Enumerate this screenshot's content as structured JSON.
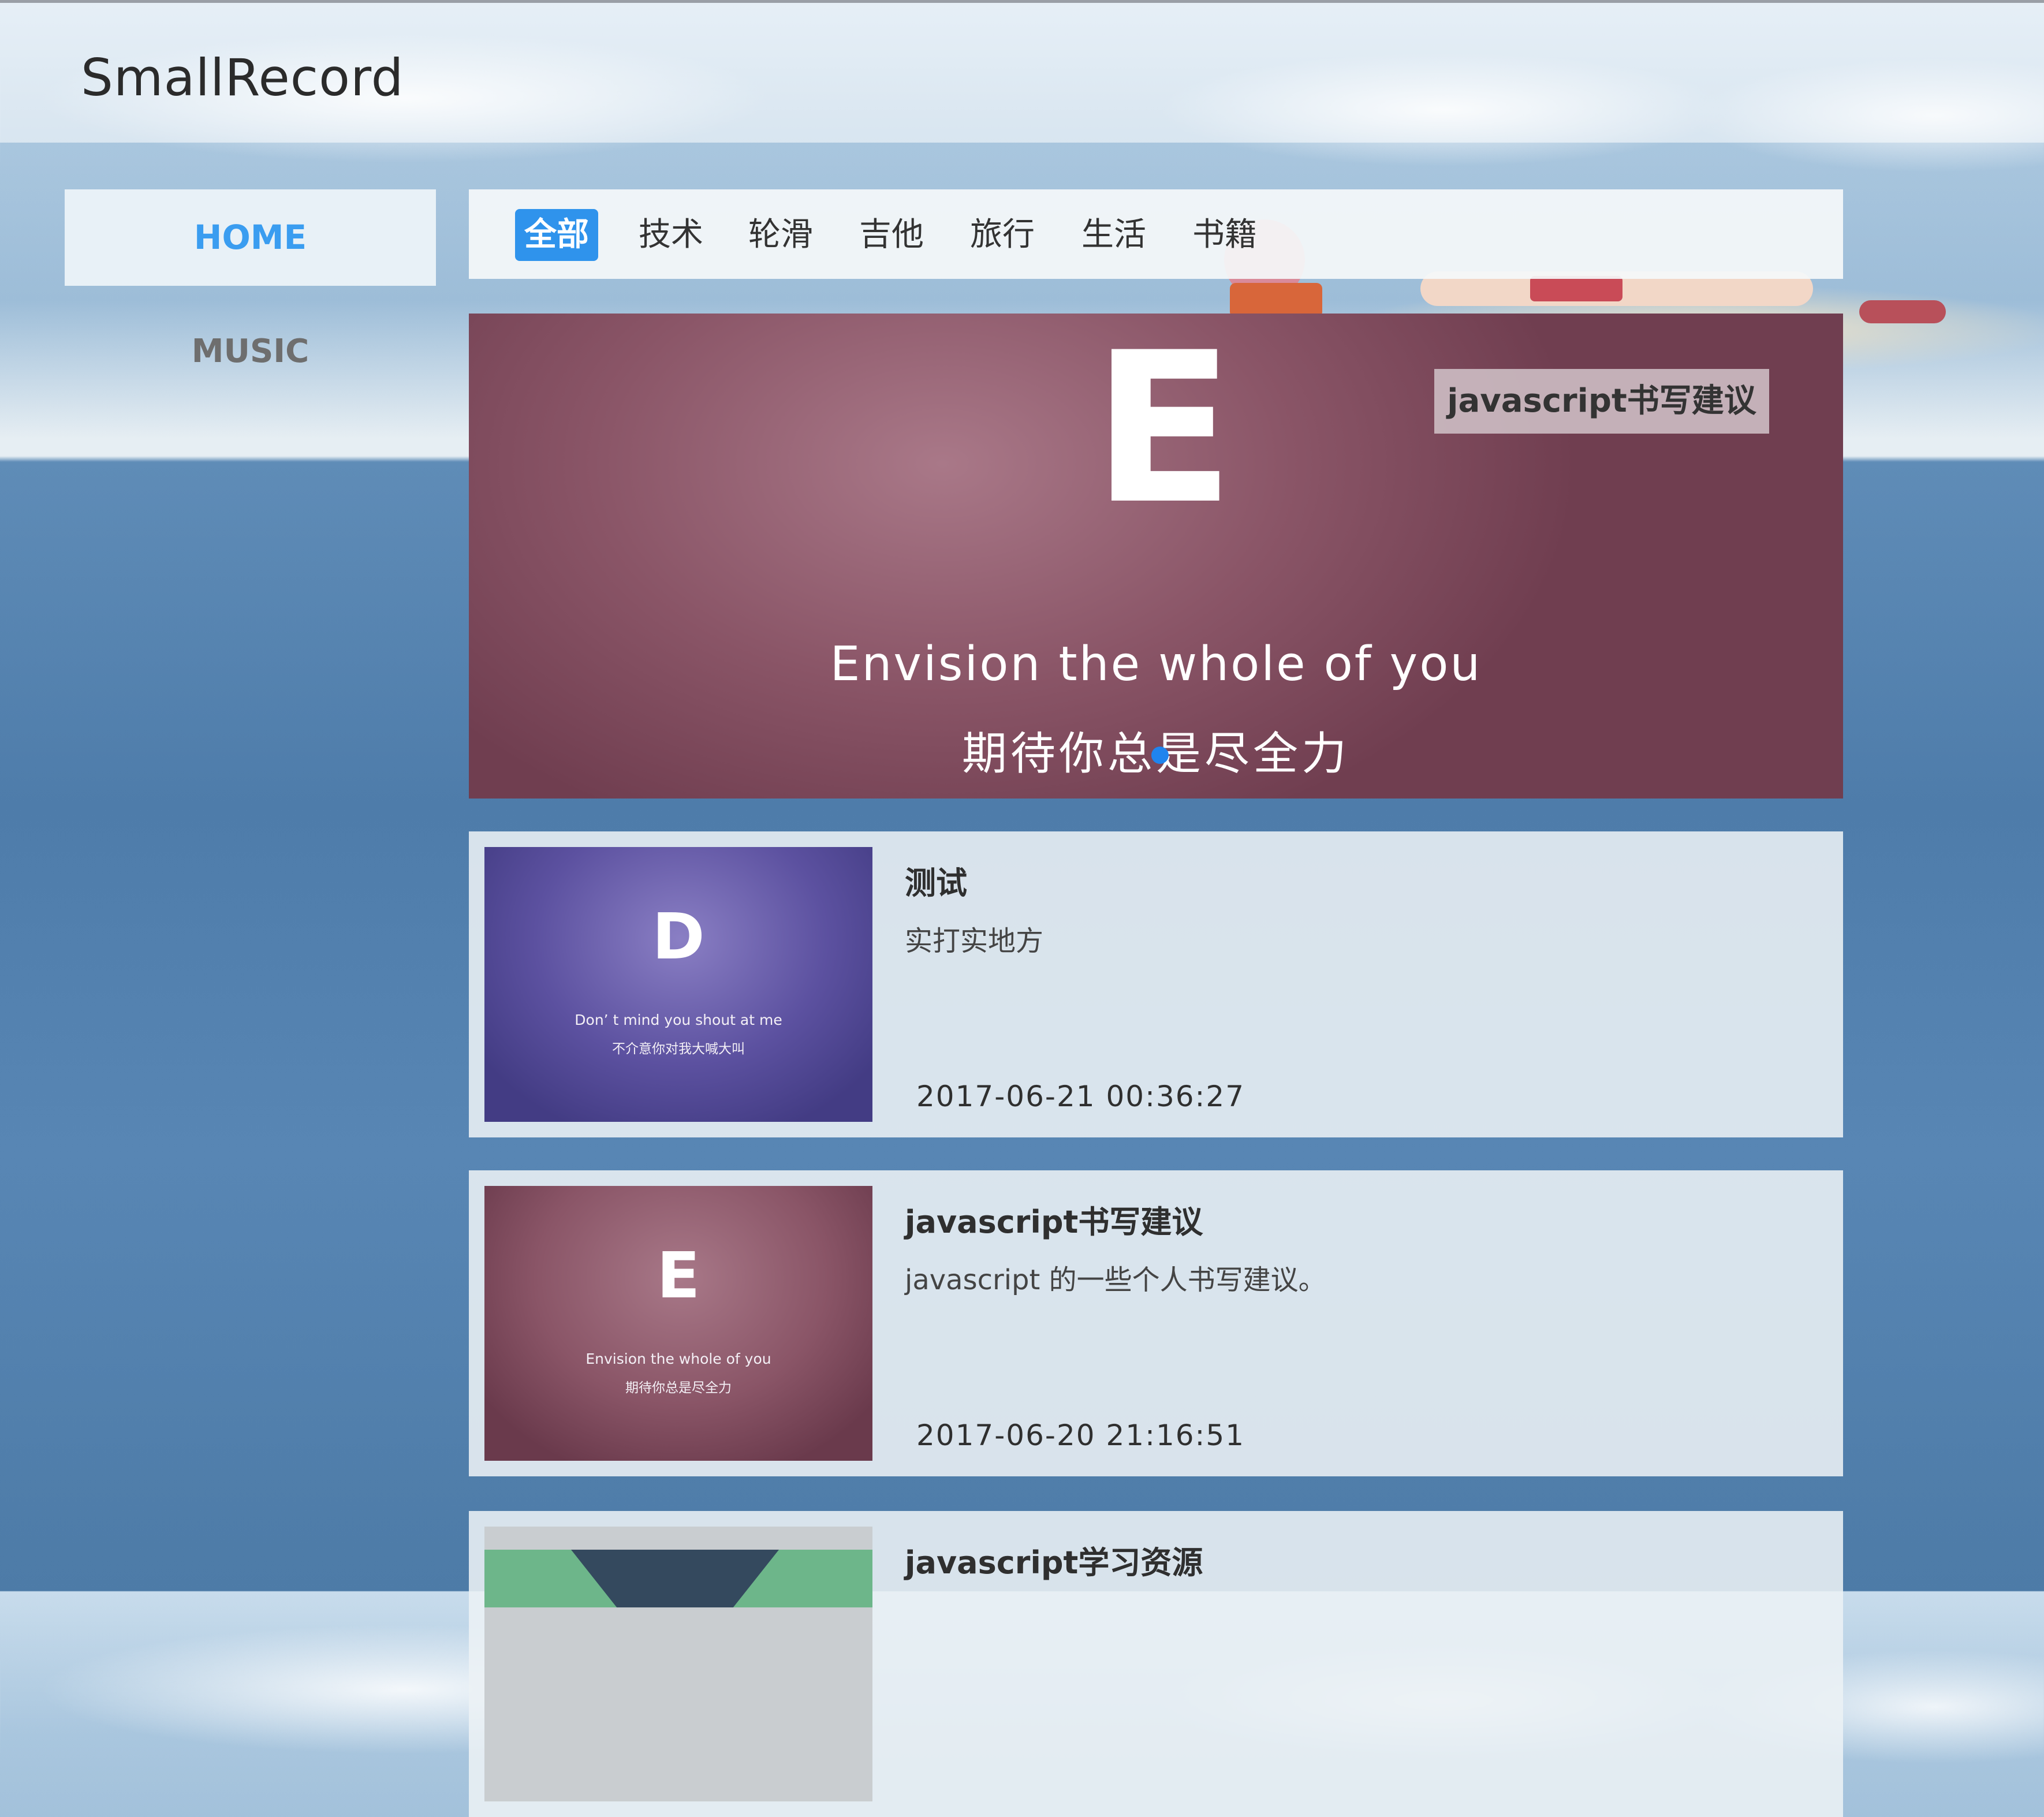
{
  "header": {
    "title": "SmallRecord"
  },
  "sidebar": {
    "items": [
      {
        "label": "HOME",
        "active": true
      },
      {
        "label": "MUSIC",
        "active": false
      }
    ]
  },
  "tabs": [
    {
      "label": "全部",
      "active": true
    },
    {
      "label": "技术",
      "active": false
    },
    {
      "label": "轮滑",
      "active": false
    },
    {
      "label": "吉他",
      "active": false
    },
    {
      "label": "旅行",
      "active": false
    },
    {
      "label": "生活",
      "active": false
    },
    {
      "label": "书籍",
      "active": false
    }
  ],
  "banner": {
    "letter": "E",
    "line1": "Envision the whole of you",
    "line2": "期待你总是尽全力",
    "tag": "javascript书写建议",
    "dot_color": "#1f84ee"
  },
  "posts": [
    {
      "title": "测试",
      "desc": "实打实地方",
      "date": "2017-06-21 00:36:27",
      "thumb": {
        "letter": "D",
        "line1": "Don’ t mind you shout at me",
        "line2": "不介意你对我大喊大叫"
      }
    },
    {
      "title": "javascript书写建议",
      "desc": "javascript 的一些个人书写建议。",
      "date": "2017-06-20 21:16:51",
      "thumb": {
        "letter": "E",
        "line1": "Envision the whole of you",
        "line2": "期待你总是尽全力"
      }
    },
    {
      "title": "javascript学习资源",
      "desc": "",
      "date": "",
      "thumb": {
        "letter": "",
        "line1": "",
        "line2": ""
      }
    }
  ],
  "colors": {
    "accent": "#2f93ec",
    "home_text": "#3a9df0"
  }
}
